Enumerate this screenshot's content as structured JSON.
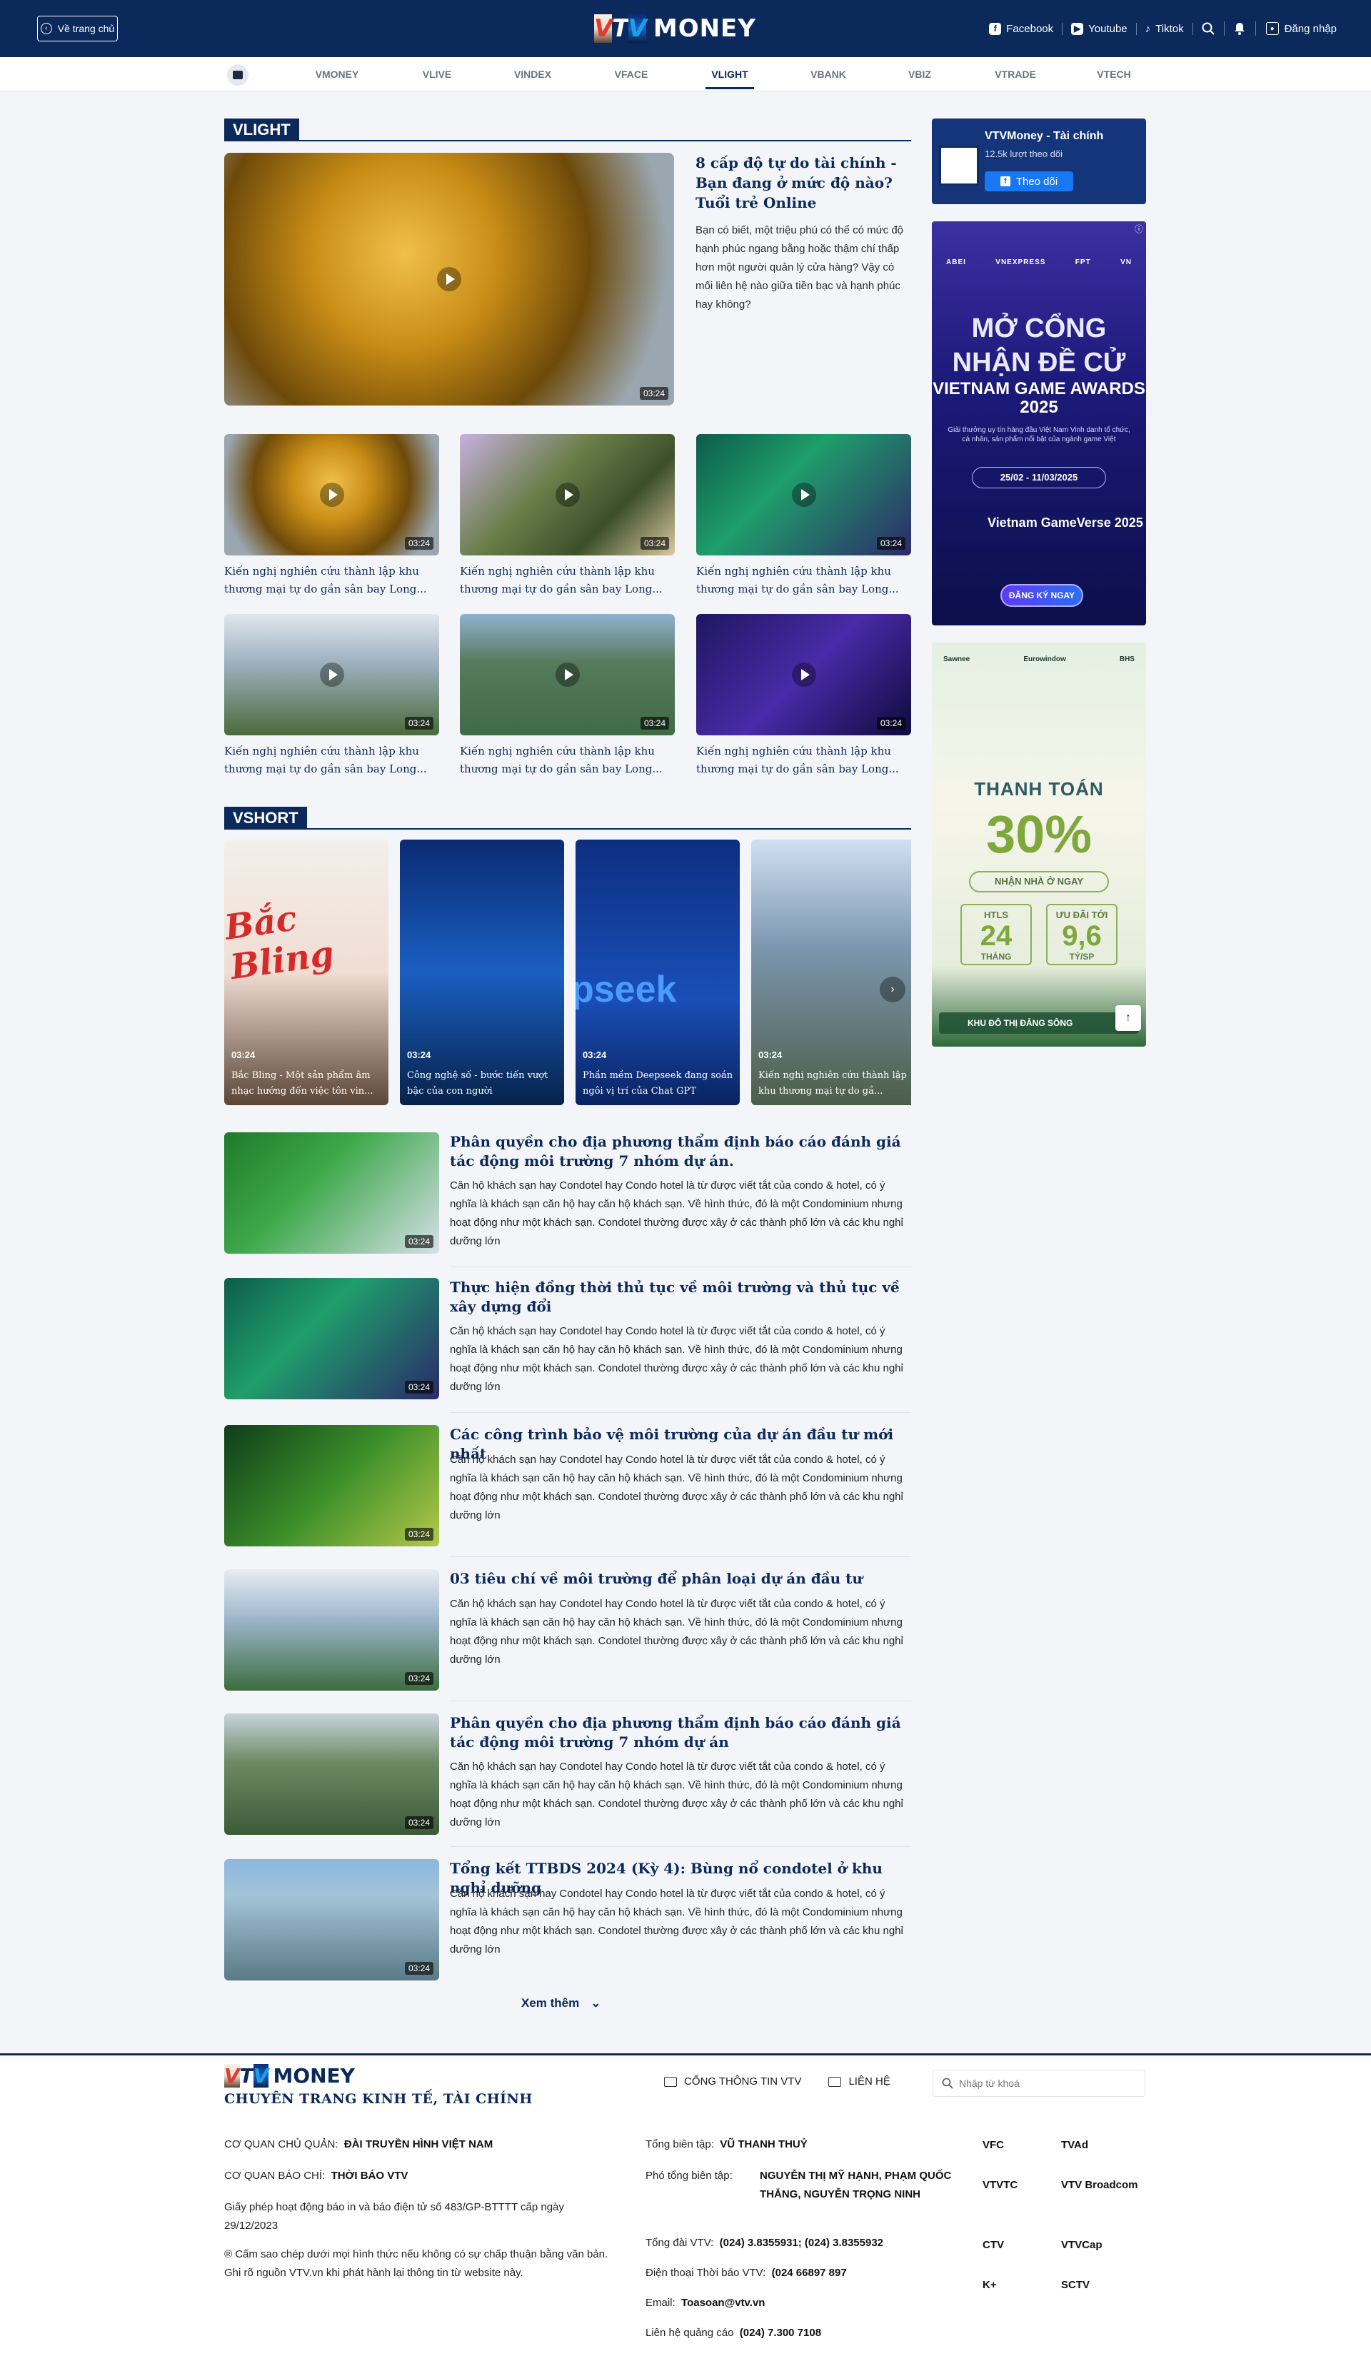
{
  "header": {
    "back_label": "Về trang chủ",
    "logo_vtv": [
      "V",
      "T",
      "V"
    ],
    "logo_money": "MONEY",
    "socials": [
      "Facebook",
      "Youtube",
      "Tiktok"
    ],
    "login_label": "Đăng nhập"
  },
  "nav": {
    "items": [
      "VMONEY",
      "VLIVE",
      "VINDEX",
      "VFACE",
      "VLIGHT",
      "VBANK",
      "VBIZ",
      "VTRADE",
      "VTECH"
    ],
    "active": "VLIGHT"
  },
  "vlight": {
    "heading": "VLIGHT",
    "featured": {
      "title": "8 cấp độ tự do tài chính - Bạn đang ở mức độ nào? Tuổi trẻ Online",
      "desc": "Bạn có biết, một triệu phú có thể có mức độ hạnh phúc ngang bằng hoặc thậm chí thấp hơn một người quản lý cửa hàng? Vậy có mối liên hệ nào giữa tiền bạc và hạnh phúc hay không?",
      "duration": "03:24"
    },
    "grid": [
      {
        "caption": "Kiến nghị nghiên cứu thành lập khu thương mại tự do gần sân bay Long...",
        "duration": "03:24"
      },
      {
        "caption": "Kiến nghị nghiên cứu thành lập khu thương mại tự do gần sân bay Long...",
        "duration": "03:24"
      },
      {
        "caption": "Kiến nghị nghiên cứu thành lập khu thương mại tự do gần sân bay Long...",
        "duration": "03:24"
      },
      {
        "caption": "Kiến nghị nghiên cứu thành lập khu thương mại tự do gần sân bay Long...",
        "duration": "03:24"
      },
      {
        "caption": "Kiến nghị nghiên cứu thành lập khu thương mại tự do gần sân bay Long...",
        "duration": "03:24"
      },
      {
        "caption": "Kiến nghị nghiên cứu thành lập khu thương mại tự do gần sân bay Long...",
        "duration": "03:24"
      }
    ]
  },
  "vshort": {
    "heading": "VSHORT",
    "items": [
      {
        "duration": "03:24",
        "title": "Bắc Bling - Một sản phẩm âm nhạc hướng đến việc tôn vin..."
      },
      {
        "duration": "03:24",
        "title": "Công nghệ số - bước tiến vượt bậc của con người"
      },
      {
        "duration": "03:24",
        "title": "Phần mềm Deepseek đang soán ngôi vị trí của Chat GPT"
      },
      {
        "duration": "03:24",
        "title": "Kiến nghị nghiên cứu thành lập khu thương mại tự do gầ..."
      }
    ],
    "thumb_texts": [
      "Bắc Bling",
      "pseek"
    ]
  },
  "list": {
    "desc": "Căn hộ khách sạn hay Condotel hay Condo hotel là từ được viết tắt của condo & hotel, có ý nghĩa là khách sạn căn hộ hay căn hộ khách sạn. Về hình thức, đó là một Condominium nhưng hoạt động như một khách sạn. Condotel thường được xây ở các thành phố lớn và các khu nghỉ dưỡng lớn",
    "items": [
      {
        "title": "Phân quyền cho địa phương thẩm định báo cáo đánh giá tác động môi trường 7 nhóm dự án.",
        "duration": "03:24"
      },
      {
        "title": "Thực hiện đồng thời thủ tục về môi trường và thủ tục về xây dựng đổi",
        "duration": "03:24"
      },
      {
        "title": "Các công trình bảo vệ môi trường của dự án đầu tư mới nhất",
        "duration": "03:24"
      },
      {
        "title": "03 tiêu chí về môi trường để phân loại dự án đầu tư",
        "duration": "03:24"
      },
      {
        "title": "Phân quyền cho địa phương thẩm định báo cáo đánh giá tác động môi trường 7 nhóm dự án",
        "duration": "03:24"
      },
      {
        "title": "Tổng kết TTBDS 2024 (Kỳ 4): Bùng nổ condotel ở khu nghỉ dưỡng",
        "duration": "03:24"
      }
    ],
    "more_label": "Xem thêm"
  },
  "sidebar": {
    "fb": {
      "name": "VTVMoney - Tài chính",
      "count": "12.5k lượt theo dõi",
      "follow": "Theo dõi"
    },
    "ad1": {
      "brands": [
        "ABEI",
        "VNEXPRESS",
        "FPT",
        "VN"
      ],
      "headline": "MỞ CỔNG NHẬN ĐỀ CỬ",
      "event": "VIETNAM GAME AWARDS 2025",
      "desc": "Giải thưởng uy tín hàng đầu Việt Nam Vinh danh tổ chức, cá nhân, sản phẩm nổi bật của ngành game Việt",
      "dates": "25/02 - 11/03/2025",
      "verse": "Vietnam GameVerse 2025",
      "cta": "ĐĂNG KÝ NGAY"
    },
    "ad2": {
      "brands": [
        "Sawnee",
        "Eurowindow",
        "BHS"
      ],
      "title": "THANH TOÁN",
      "percent": "30%",
      "pill": "NHẬN NHÀ Ở NGAY",
      "box1": {
        "k": "HTLS",
        "v": "24",
        "u": "THÁNG"
      },
      "box2": {
        "k": "ƯU ĐÃI TỚI",
        "v": "9,6",
        "u": "TỶ/SP"
      },
      "bottom": "KHU ĐÔ THỊ ĐẢNG SÔNG"
    }
  },
  "footer": {
    "logo_vtv": [
      "V",
      "T",
      "V"
    ],
    "logo_money": "MONEY",
    "subtitle": "CHUYÊN TRANG KINH TẾ, TÀI CHÍNH",
    "links": [
      "CỔNG THÔNG TIN VTV",
      "LIÊN HỆ"
    ],
    "search_placeholder": "Nhập từ khoá",
    "owner_label": "CƠ QUAN CHỦ QUẢN:",
    "owner": "ĐÀI TRUYỀN HÌNH VIỆT NAM",
    "press_label": "CƠ QUAN BÁO CHÍ:",
    "press": "THỜI BÁO VTV",
    "license": "Giấy phép hoạt động báo in và báo điện tử số 483/GP-BTTTT cấp ngày 29/12/2023",
    "copyright": "® Cấm sao chép dưới mọi hình thức nếu không có sự chấp thuận bằng văn bản. Ghi rõ nguồn VTV.vn khi phát hành lại thông tin từ website này.",
    "editor_label": "Tổng biên tập:",
    "editor": "VŨ THANH THUỶ",
    "deputy_label": "Phó tổng biên tập:",
    "deputy": "NGUYỄN THỊ MỸ HẠNH, PHẠM QUỐC THẮNG, NGUYỄN TRỌNG NINH",
    "hotline_label": "Tổng đài VTV:",
    "hotline": "(024) 3.8355931; (024) 3.8355932",
    "phone_label": "Điện thoại Thời báo VTV:",
    "phone": "(024 66897 897",
    "email_label": "Email:",
    "email": "Toasoan@vtv.vn",
    "ads_label": "Liên hệ quảng cáo",
    "ads": "(024) 7.300 7108",
    "channels": [
      "VFC",
      "TVAd",
      "VTVTC",
      "VTV Broadcom",
      "CTV",
      "VTVCap",
      "K+",
      "SCTV"
    ]
  }
}
